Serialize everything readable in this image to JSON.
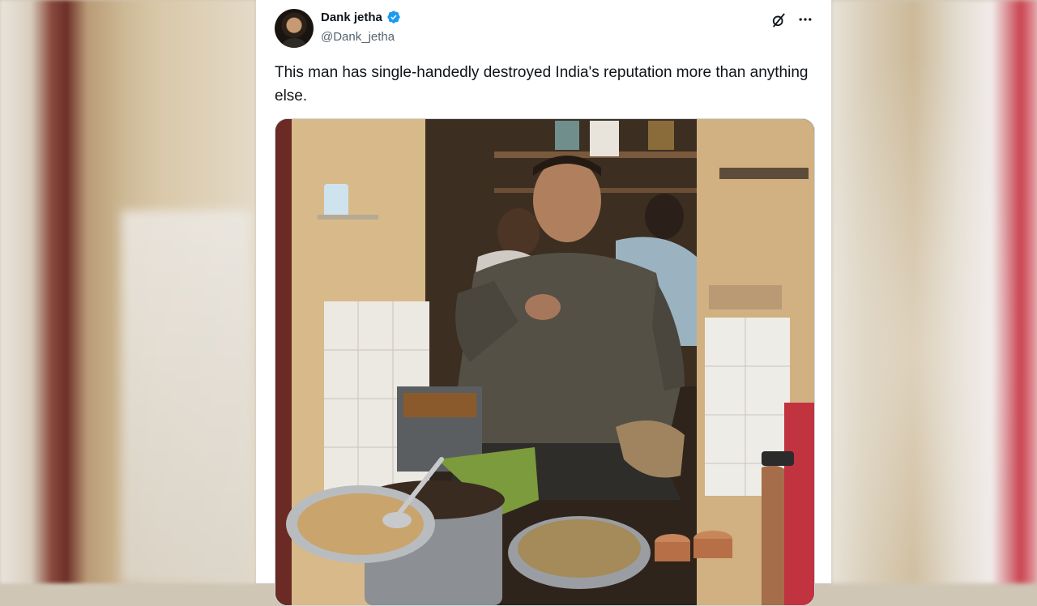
{
  "tweet": {
    "display_name": "Dank jetha",
    "handle": "@Dank_jetha",
    "verified": true,
    "text": "This man has single-handedly destroyed India's reputation more than anything else.",
    "media_description_icon": "photo"
  },
  "icons": {
    "verified": "verified-badge-icon",
    "grok": "grok-icon",
    "more": "more-options-icon"
  },
  "colors": {
    "accent": "#1d9bf0",
    "text_primary": "#0f1419",
    "text_secondary": "#536471"
  }
}
